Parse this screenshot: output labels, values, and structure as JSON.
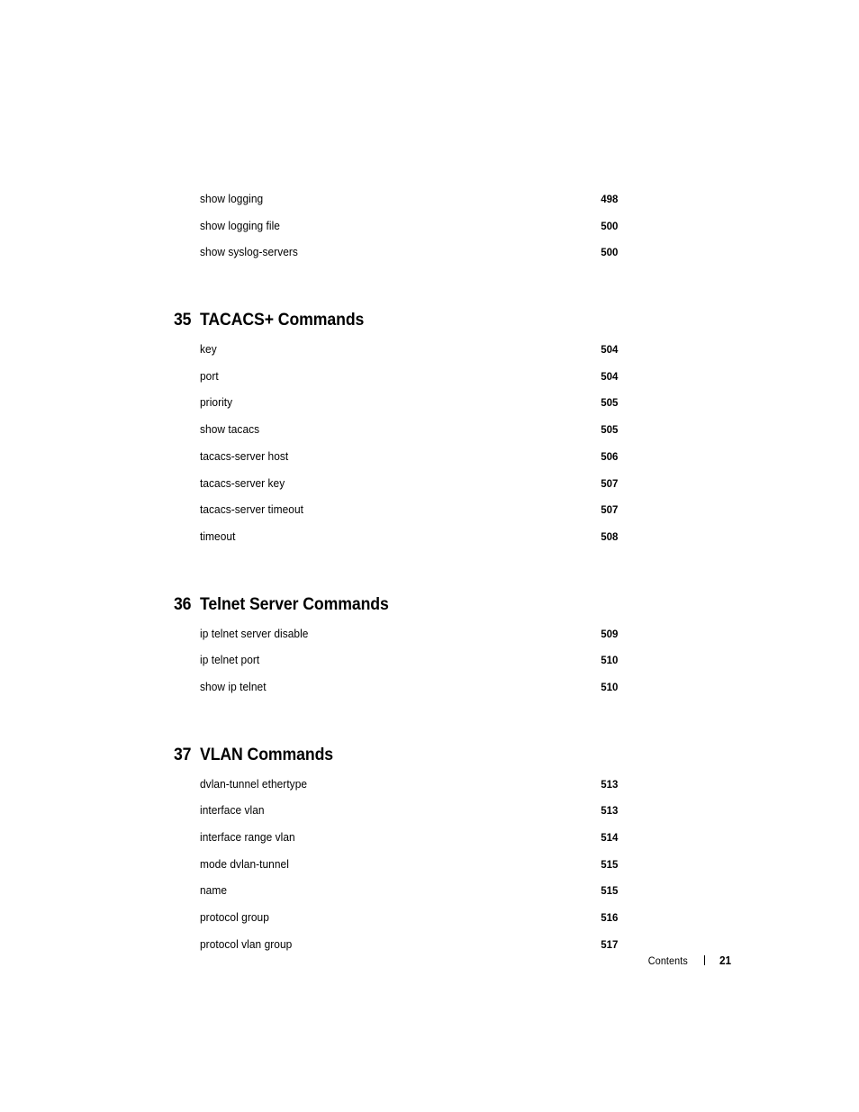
{
  "document": {
    "type": "table-of-contents",
    "footer": {
      "label": "Contents",
      "separator": "|",
      "page_number": "21"
    }
  },
  "toc": {
    "groups": [
      {
        "chapter_number": "",
        "chapter_title": "",
        "entries": [
          {
            "label": "show logging",
            "page": "498"
          },
          {
            "label": "show logging file",
            "page": "500"
          },
          {
            "label": "show syslog-servers",
            "page": "500"
          }
        ]
      },
      {
        "chapter_number": "35",
        "chapter_title": "TACACS+ Commands",
        "entries": [
          {
            "label": "key",
            "page": "504"
          },
          {
            "label": "port",
            "page": "504"
          },
          {
            "label": "priority",
            "page": "505"
          },
          {
            "label": "show tacacs",
            "page": "505"
          },
          {
            "label": "tacacs-server host",
            "page": "506"
          },
          {
            "label": "tacacs-server key",
            "page": "507"
          },
          {
            "label": "tacacs-server timeout",
            "page": "507"
          },
          {
            "label": "timeout",
            "page": "508"
          }
        ]
      },
      {
        "chapter_number": "36",
        "chapter_title": "Telnet Server Commands",
        "entries": [
          {
            "label": "ip telnet server disable",
            "page": "509"
          },
          {
            "label": "ip telnet port",
            "page": "510"
          },
          {
            "label": "show ip telnet",
            "page": "510"
          }
        ]
      },
      {
        "chapter_number": "37",
        "chapter_title": "VLAN Commands",
        "entries": [
          {
            "label": "dvlan-tunnel ethertype",
            "page": "513"
          },
          {
            "label": "interface vlan",
            "page": "513"
          },
          {
            "label": "interface range vlan",
            "page": "514"
          },
          {
            "label": "mode dvlan-tunnel",
            "page": "515"
          },
          {
            "label": "name",
            "page": "515"
          },
          {
            "label": "protocol group",
            "page": "516"
          },
          {
            "label": "protocol vlan group",
            "page": "517"
          }
        ]
      }
    ]
  }
}
